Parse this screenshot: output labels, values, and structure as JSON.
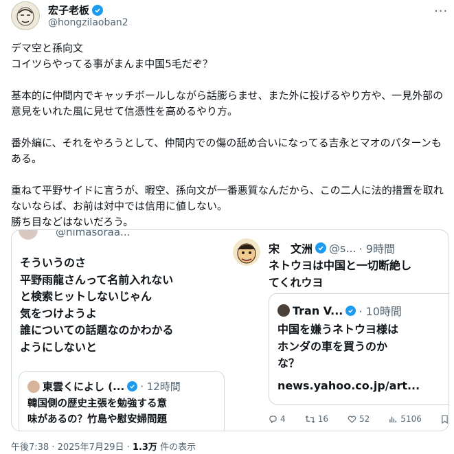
{
  "post": {
    "display_name": "宏子老板",
    "handle": "@hongzilaoban2",
    "body": "デマ空と孫向文\nコイツらやってる事がまんま中国5毛だぞ？\n\n基本的に仲間内でキャッチボールしながら話膨らませ、また外に投げるやり方や、一見外部の意見をいれた風に見せて信憑性を高めるやり方。\n\n番外編に、それをやろうとして、仲間内での傷の舐め合いになってる吉永とマオのパターンもある。\n\n重ねて平野サイドに言うが、暇空、孫向文が一番悪質なんだから、この二人に法的措置を取れないならば、お前は対中では信用に値しない。\n勝ち目などはないだろう。",
    "timestamp": "午後7:38 · 2025年7月29日",
    "views_count": "1.3万",
    "views_label": "件の表示"
  },
  "screenshot": {
    "left_handle": "@himasoraa...",
    "left_text": "そういうのさ\n平野雨龍さんって名前入れない\nと検索ヒットしないじゃん\n気をつけようよ\n誰についての話題なのかわかる\nようにしないと",
    "left_quote_name": "東雲くによし (...",
    "left_quote_time": "· 12時間",
    "left_quote_text": "韓国側の歴史主張を勉強する意\n味があるの？竹島や慰安婦問題",
    "right_name": "宋　文洲",
    "right_handle": "@s...",
    "right_time": "· 9時間",
    "right_text": "ネトウヨは中国と一切断絶し\nてくれウヨ",
    "right_quote_name": "Tran V...",
    "right_quote_time": "· 10時間",
    "right_quote_text": "中国を嫌うネトウヨ様は\nホンダの車を買うのか\nな？",
    "right_quote_link": "news.yahoo.co.jp/art...",
    "stats": {
      "replies": "4",
      "reposts": "16",
      "likes": "52",
      "views": "5106"
    }
  },
  "colors": {
    "verified": "#1d9bf0",
    "text": "#0f1419",
    "muted": "#536471",
    "border": "#cfd9de"
  },
  "icons": [
    "verified-badge-icon",
    "more-icon",
    "reply-icon",
    "repost-icon",
    "like-icon",
    "views-icon",
    "bookmark-icon"
  ]
}
